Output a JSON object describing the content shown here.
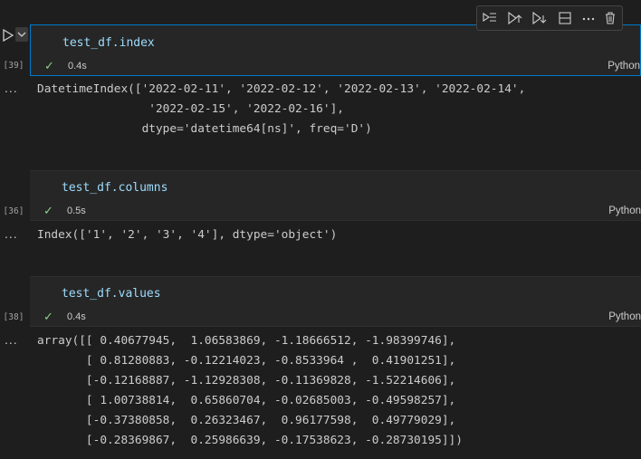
{
  "cells": [
    {
      "code": "test_df.index",
      "exec_count": "[39]",
      "time": "0.4s",
      "language": "Python",
      "output_marker": "...",
      "output": "DatetimeIndex(['2022-02-11', '2022-02-12', '2022-02-13', '2022-02-14',\n                '2022-02-15', '2022-02-16'],\n               dtype='datetime64[ns]', freq='D')"
    },
    {
      "code": "test_df.columns",
      "exec_count": "[36]",
      "time": "0.5s",
      "language": "Python",
      "output_marker": "...",
      "output": "Index(['1', '2', '3', '4'], dtype='object')"
    },
    {
      "code": "test_df.values",
      "exec_count": "[38]",
      "time": "0.4s",
      "language": "Python",
      "output_marker": "...",
      "output": "array([[ 0.40677945,  1.06583869, -1.18666512, -1.98399746],\n       [ 0.81280883, -0.12214023, -0.8533964 ,  0.41901251],\n       [-0.12168887, -1.12928308, -0.11369828, -1.52214606],\n       [ 1.00738814,  0.65860704, -0.02685003, -0.49598257],\n       [-0.37380858,  0.26323467,  0.96177598,  0.49779029],\n       [-0.28369867,  0.25986639, -0.17538623, -0.28730195]])"
    }
  ],
  "toolbar_icons": [
    "execute-above-icon",
    "execute-cell-and-below-icon",
    "execute-cell-and-above-icon",
    "split-cell-icon",
    "more-actions-icon",
    "delete-icon"
  ],
  "colors": {
    "accent": "#007acc",
    "success": "#89d185",
    "code": "#9cdcfe"
  }
}
